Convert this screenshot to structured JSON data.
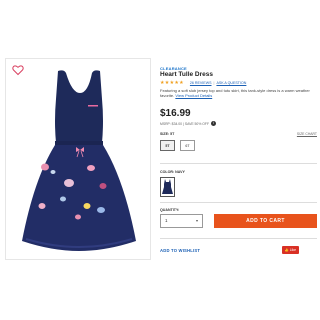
{
  "product": {
    "badge": "CLEARANCE",
    "title": "Heart Tulle Dress",
    "stars": "★★★★★",
    "reviews": "26 REVIEWS",
    "separator": "|",
    "ask_question": "ASK A QUESTION",
    "description": "Featuring a soft slub jersey top and tutu skirt, this tank-style dress is a warm weather favorite.",
    "view_details": "View Product Details",
    "price": "$16.99",
    "msrp": "MSRP: $34.00 | SAVE 50% OFF",
    "info_icon_glyph": "i"
  },
  "size": {
    "label": "SIZE: 5T",
    "size_chart": "SIZE CHART",
    "options": [
      "5T",
      "6T"
    ],
    "selected": "5T"
  },
  "color": {
    "label": "COLOR: NAVY",
    "swatch_color": "#1e2a5a"
  },
  "quantity": {
    "label": "QUANTITY:",
    "value": "1",
    "caret": "▾"
  },
  "actions": {
    "add_to_cart": "ADD TO CART",
    "add_to_wishlist": "ADD TO WISHLIST",
    "like_label": "👍 Like"
  },
  "colors": {
    "accent_orange": "#e8531c",
    "link_blue": "#1a5fb4",
    "dress_navy": "#1e2a5a"
  }
}
